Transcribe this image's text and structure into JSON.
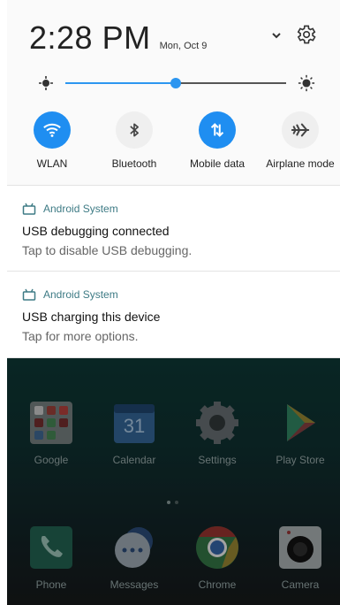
{
  "quick_settings": {
    "time": "2:28 PM",
    "date": "Mon, Oct 9",
    "brightness_level": 0.5,
    "tiles": [
      {
        "label": "WLAN",
        "icon": "wifi-icon",
        "on": true
      },
      {
        "label": "Bluetooth",
        "icon": "bluetooth-icon",
        "on": false
      },
      {
        "label": "Mobile data",
        "icon": "mobile-data-icon",
        "on": true
      },
      {
        "label": "Airplane mode",
        "icon": "airplane-icon",
        "on": false
      }
    ],
    "accent_color": "#1f8ef1"
  },
  "notifications": [
    {
      "app": "Android System",
      "title": "USB debugging connected",
      "body": "Tap to disable USB debugging."
    },
    {
      "app": "Android System",
      "title": "USB charging this device",
      "body": "Tap for more options."
    }
  ],
  "home": {
    "apps_row1": [
      {
        "label": "Google",
        "icon": "google-folder-icon"
      },
      {
        "label": "Calendar",
        "icon": "calendar-icon",
        "badge": "31"
      },
      {
        "label": "Settings",
        "icon": "settings-app-icon"
      },
      {
        "label": "Play Store",
        "icon": "play-store-icon"
      }
    ],
    "dock": [
      {
        "label": "Phone",
        "icon": "phone-icon"
      },
      {
        "label": "Messages",
        "icon": "messages-icon"
      },
      {
        "label": "Chrome",
        "icon": "chrome-icon"
      },
      {
        "label": "Camera",
        "icon": "camera-icon"
      }
    ]
  }
}
